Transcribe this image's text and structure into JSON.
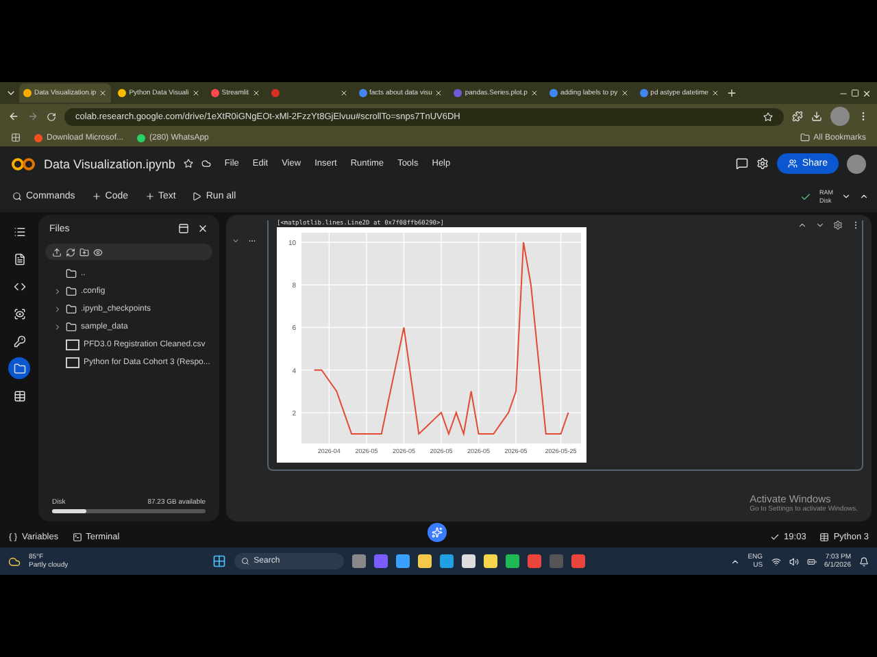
{
  "browser": {
    "tabs": [
      {
        "title": "Data Visualization.ip",
        "selected": true
      },
      {
        "title": "Python Data Visuali",
        "selected": false
      },
      {
        "title": "Streamlit",
        "selected": false
      },
      {
        "selected": false
      },
      {
        "title": "facts about data visu",
        "selected": false
      },
      {
        "title": "pandas.Series.plot.p",
        "selected": false
      },
      {
        "title": "adding labels to py",
        "selected": false
      },
      {
        "title": "pd astype datetime",
        "selected": false
      }
    ],
    "url": "colab.research.google.com/drive/1eXtR0iGNgEOt-xMl-2FzzYt8GjElvuu#scrollTo=snps7TnUV6DH",
    "bookmarks": [
      "Download Microsof...",
      "(280) WhatsApp"
    ],
    "all_bookmarks": "All Bookmarks"
  },
  "colab": {
    "title": "Data Visualization.ipynb",
    "menu": [
      "File",
      "Edit",
      "View",
      "Insert",
      "Runtime",
      "Tools",
      "Help"
    ],
    "share": "Share",
    "toolbar": [
      "Commands",
      "Code",
      "Text",
      "Run all"
    ],
    "ram": "RAM",
    "disk": "Disk"
  },
  "sidebar": {
    "items": [
      {
        "selected": false
      },
      {
        "selected": false
      },
      {
        "selected": false
      },
      {
        "selected": false
      },
      {
        "selected": false
      },
      {
        "selected": true
      },
      {
        "selected": false
      }
    ]
  },
  "files": {
    "title": "Files",
    "items": [
      {
        "name": "..",
        "kind": "folder",
        "expandable": false
      },
      {
        "name": ".config",
        "kind": "folder",
        "expandable": true
      },
      {
        "name": ".ipynb_checkpoints",
        "kind": "folder",
        "expandable": true
      },
      {
        "name": "sample_data",
        "kind": "folder",
        "expandable": true
      },
      {
        "name": "PFD3.0 Registration Cleaned.csv",
        "kind": "file",
        "expandable": false
      },
      {
        "name": "Python for Data Cohort 3 (Respo...",
        "kind": "file",
        "expandable": false
      }
    ],
    "disk": {
      "label": "Disk",
      "available": "87.23 GB available",
      "level": 0.22
    }
  },
  "cell": {
    "output_text": "[<matplotlib.lines.Line2D at 0x7f08ffb60290>]",
    "chart_data": {
      "type": "line",
      "categories": [
        null,
        null,
        "2026-04",
        null,
        null,
        null,
        null,
        "2026-05",
        null,
        null,
        null,
        null,
        "2026-05",
        null,
        null,
        null,
        null,
        "2026-05",
        null,
        null,
        null,
        null,
        "2026-05",
        null,
        null,
        null,
        null,
        "2026-05",
        null,
        null,
        null,
        null,
        null,
        "2026-05-25",
        null
      ],
      "series": [
        {
          "color": "#e24a33",
          "values": [
            4,
            4,
            3.5,
            3,
            2,
            1,
            1,
            1,
            1,
            1,
            2.67,
            4.33,
            6,
            3.5,
            1,
            1.33,
            1.67,
            2,
            1,
            2,
            1,
            3,
            1,
            1,
            1,
            1.5,
            2,
            3,
            10,
            8,
            4.5,
            1,
            1,
            1,
            2
          ]
        }
      ],
      "ylim": [
        0.55,
        10.45
      ],
      "yticks": [
        2,
        4,
        6,
        8,
        10
      ],
      "grid": true
    }
  },
  "status": {
    "variables": "Variables",
    "terminal": "Terminal",
    "time": "19:03",
    "runtime": "Python 3"
  },
  "activation": {
    "title": "Activate Windows",
    "subtitle": "Go to Settings to activate Windows."
  },
  "taskbar": {
    "temperature": "85°F",
    "weather": "Partly cloudy",
    "search": "Search",
    "lang": "ENG",
    "region": "US",
    "time": "7:03 PM",
    "date": "6/1/2026"
  }
}
